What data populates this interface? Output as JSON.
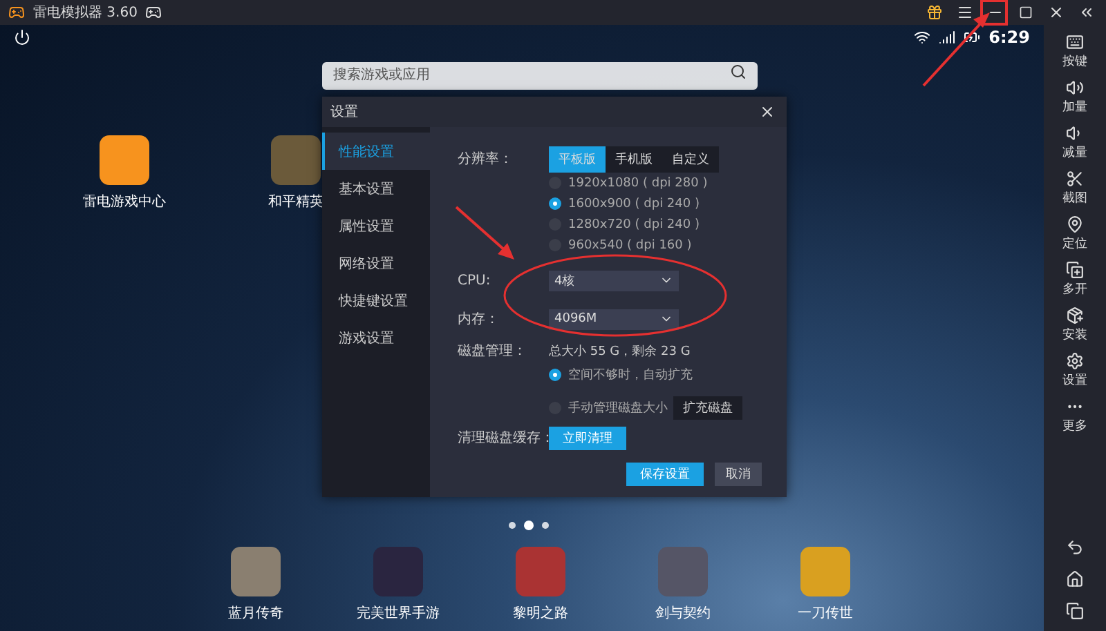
{
  "window": {
    "title": "雷电模拟器 3.60"
  },
  "status_bar": {
    "time": "6:29"
  },
  "search": {
    "placeholder": "搜索游戏或应用"
  },
  "desktop_apps": [
    {
      "label": "雷电游戏中心"
    },
    {
      "label": "和平精英"
    }
  ],
  "page_dots": [
    {
      "selected": false
    },
    {
      "selected": true
    },
    {
      "selected": false
    }
  ],
  "dock_apps": [
    {
      "label": "蓝月传奇"
    },
    {
      "label": "完美世界手游"
    },
    {
      "label": "黎明之路"
    },
    {
      "label": "剑与契约"
    },
    {
      "label": "一刀传世"
    }
  ],
  "toolbar": [
    {
      "label": "按键"
    },
    {
      "label": "加量"
    },
    {
      "label": "减量"
    },
    {
      "label": "截图"
    },
    {
      "label": "定位"
    },
    {
      "label": "多开"
    },
    {
      "label": "安装"
    },
    {
      "label": "设置"
    },
    {
      "label": "更多"
    }
  ],
  "dialog": {
    "title": "设置",
    "tabs": [
      {
        "label": "性能设置",
        "selected": true
      },
      {
        "label": "基本设置",
        "selected": false
      },
      {
        "label": "属性设置",
        "selected": false
      },
      {
        "label": "网络设置",
        "selected": false
      },
      {
        "label": "快捷键设置",
        "selected": false
      },
      {
        "label": "游戏设置",
        "selected": false
      }
    ],
    "resolution": {
      "label": "分辨率：",
      "modes": [
        {
          "label": "平板版",
          "selected": true
        },
        {
          "label": "手机版",
          "selected": false
        },
        {
          "label": "自定义",
          "selected": false
        }
      ],
      "options": [
        {
          "label": "1920x1080 ( dpi 280 )",
          "selected": false
        },
        {
          "label": "1600x900 ( dpi 240 )",
          "selected": true
        },
        {
          "label": "1280x720 ( dpi 240 )",
          "selected": false
        },
        {
          "label": "960x540 ( dpi 160 )",
          "selected": false
        }
      ]
    },
    "cpu": {
      "label": "CPU:",
      "value": "4核"
    },
    "memory": {
      "label": "内存：",
      "value": "4096M"
    },
    "disk": {
      "label": "磁盘管理：",
      "info": "总大小 55 G，剩余 23 G",
      "options": [
        {
          "label": "空间不够时，自动扩充",
          "selected": true
        },
        {
          "label": "手动管理磁盘大小",
          "selected": false
        }
      ],
      "expand_button": "扩充磁盘"
    },
    "cache": {
      "label": "清理磁盘缓存：",
      "button": "立即清理"
    },
    "buttons": {
      "save": "保存设置",
      "cancel": "取消"
    }
  }
}
